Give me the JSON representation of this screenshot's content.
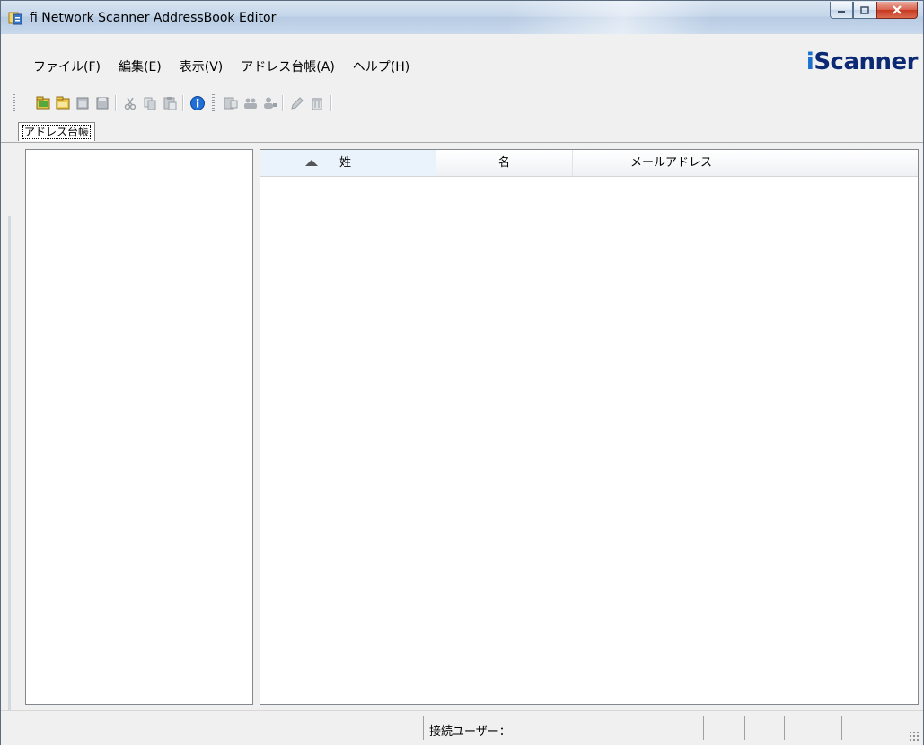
{
  "window": {
    "title": "fi Network Scanner AddressBook Editor",
    "logo": "Scanner",
    "logo_prefix": "i"
  },
  "menu": [
    {
      "label": "ファイル(F)"
    },
    {
      "label": "編集(E)"
    },
    {
      "label": "表示(V)"
    },
    {
      "label": "アドレス台帳(A)"
    },
    {
      "label": "ヘルプ(H)"
    }
  ],
  "toolbar": {
    "buttons": [
      "new-book-icon",
      "open-book-icon",
      "close-book-icon",
      "save-icon",
      "cut-icon",
      "copy-icon",
      "paste-icon",
      "info-icon",
      "add-entry-icon",
      "add-group-icon",
      "add-user-icon",
      "edit-icon",
      "delete-icon"
    ]
  },
  "tabs": [
    {
      "label": "アドレス台帳"
    }
  ],
  "table": {
    "columns": [
      "姓",
      "名",
      "メールアドレス",
      ""
    ]
  },
  "statusbar": {
    "connected_user": "接続ユーザー："
  },
  "colors": {
    "title_bar": "#c5d6ea",
    "close_button": "#c6381f",
    "logo_blue": "#0b2a73"
  }
}
